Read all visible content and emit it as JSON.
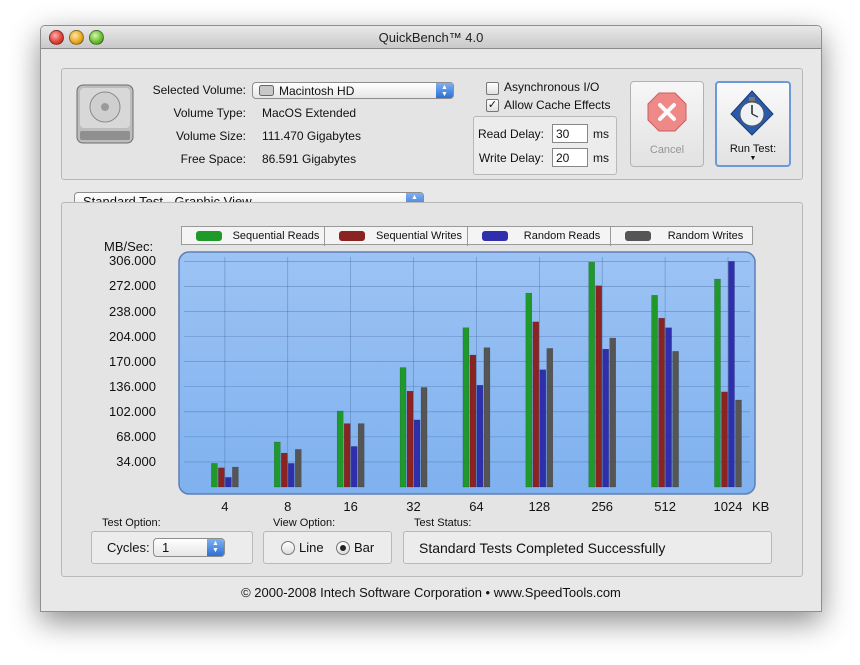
{
  "window": {
    "title": "QuickBench™ 4.0"
  },
  "volume": {
    "selected_label": "Selected Volume:",
    "selected_value": "Macintosh HD",
    "type_label": "Volume Type:",
    "type_value": "MacOS Extended",
    "size_label": "Volume Size:",
    "size_value": "111.470 Gigabytes",
    "free_label": "Free Space:",
    "free_value": "86.591 Gigabytes"
  },
  "options": {
    "async_label": "Asynchronous I/O",
    "async_checked": false,
    "cache_label": "Allow Cache Effects",
    "cache_checked": true,
    "read_delay_label": "Read Delay:",
    "read_delay_value": "30",
    "write_delay_label": "Write Delay:",
    "write_delay_value": "20",
    "unit_ms": "ms"
  },
  "buttons": {
    "cancel": "Cancel",
    "run": "Run Test:"
  },
  "view_select": "Standard Test - Graphic View",
  "chart_data": {
    "type": "bar",
    "ylabel": "MB/Sec:",
    "xunit": "KB",
    "categories": [
      "4",
      "8",
      "16",
      "32",
      "64",
      "128",
      "256",
      "512",
      "1024"
    ],
    "yticks": [
      "306.000",
      "272.000",
      "238.000",
      "204.000",
      "170.000",
      "136.000",
      "102.000",
      "68.000",
      "34.000"
    ],
    "ylim": [
      0,
      312
    ],
    "series": [
      {
        "name": "Sequential Reads",
        "color": "#1f9a2a",
        "values": [
          32,
          61,
          103,
          162,
          216,
          263,
          305,
          260,
          282
        ]
      },
      {
        "name": "Sequential Writes",
        "color": "#8b2323",
        "values": [
          26,
          46,
          86,
          130,
          179,
          224,
          273,
          229,
          129
        ]
      },
      {
        "name": "Random Reads",
        "color": "#2f2fae",
        "values": [
          13,
          32,
          55,
          91,
          138,
          159,
          187,
          216,
          306
        ]
      },
      {
        "name": "Random Writes",
        "color": "#555555",
        "values": [
          27,
          51,
          86,
          135,
          189,
          188,
          202,
          184,
          118
        ]
      }
    ]
  },
  "test_option": {
    "label": "Test Option:",
    "cycles_label": "Cycles:",
    "cycles_value": "1"
  },
  "view_option": {
    "label": "View Option:",
    "line": "Line",
    "bar": "Bar",
    "selected": "Bar"
  },
  "status": {
    "label": "Test Status:",
    "text": "Standard Tests Completed Successfully"
  },
  "footer": "© 2000-2008 Intech Software Corporation • www.SpeedTools.com"
}
